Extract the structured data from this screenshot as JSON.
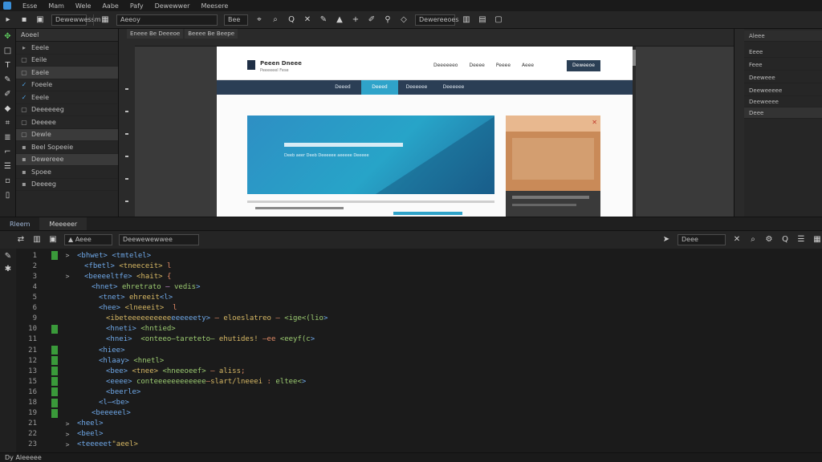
{
  "menubar": {
    "items": [
      "Esse",
      "Mam",
      "Wele",
      "Aabe",
      "Pafy",
      "Dewewwer",
      "Meesere"
    ]
  },
  "toolbar": {
    "workspace": "Dewewwessm",
    "view": "Aeeoy",
    "mode": "Bee",
    "right_label": "Dewereeoes",
    "accent_color": "#3a8fd8"
  },
  "left_panel": {
    "title": "Aoeel",
    "layers": [
      {
        "label": "Eeele"
      },
      {
        "label": "Eeile"
      },
      {
        "label": "Eaele"
      },
      {
        "label": "Foeele"
      },
      {
        "label": "Eeele"
      },
      {
        "label": "Deeeeeeg"
      },
      {
        "label": "Deeeee"
      },
      {
        "label": "Dewle"
      },
      {
        "label": "Beel Sopeeie"
      },
      {
        "label": "Dewereee"
      },
      {
        "label": "Spoee"
      },
      {
        "label": "Deeeeg"
      }
    ]
  },
  "canvas": {
    "tabs": [
      "Eneee Be Deeeoe",
      "Beeee Be Beepe"
    ],
    "site": {
      "title": "Peeen Dneee",
      "subtitle": "Peeeeeel Fese",
      "nav": [
        "Deeeeeeo",
        "Deeee",
        "Peeee",
        "Aeee"
      ],
      "cta": "Deweeoe",
      "menu": [
        "Deeed",
        "Deeed",
        "Deeeeee",
        "Deeeeee"
      ],
      "hero_tagline": "Deeb aeer Deeb Deeeeee aeeeee Deeeee"
    }
  },
  "right_panel": {
    "title": "Aleee",
    "items": [
      "Eeee",
      "Feee",
      "Deeweee",
      "Deeweeeee",
      "Deeweeee",
      "Deee"
    ]
  },
  "editor": {
    "tabs": [
      "Rleem",
      "Meeeeer"
    ],
    "search_label": "Deee",
    "file_label": "Deewewewwee",
    "lines": [
      {
        "n": "1",
        "green": true,
        "fold": ">",
        "indent": 0,
        "html": "<span class='tag'>&lt;bhwet&gt;</span> <span class='tag'>&lt;tmtelel&gt;</span>"
      },
      {
        "n": "2",
        "green": false,
        "fold": "",
        "indent": 1,
        "html": "<span class='tag'>&lt;fbetl&gt;</span> <span class='attr'>&lt;tneeceit&gt;</span> <span class='op'>l</span>"
      },
      {
        "n": "3",
        "green": false,
        "fold": ">",
        "indent": 1,
        "html": "<span class='tag'>&lt;beeeeltfe&gt;</span> <span class='attr'>&lt;hait&gt;</span> <span class='op'>{</span>"
      },
      {
        "n": "4",
        "green": false,
        "fold": "",
        "indent": 2,
        "html": "<span class='tag'>&lt;hnet&gt;</span> <span class='txt'>ehretrato</span> <span class='str'>–</span> <span class='txt'>vedis</span><span class='tag'>&gt;</span>"
      },
      {
        "n": "5",
        "green": false,
        "fold": "",
        "indent": 3,
        "html": "<span class='tag'>&lt;tnet&gt;</span> <span class='attr'>ehreeit</span><span class='tag'>&lt;l&gt;</span>"
      },
      {
        "n": "6",
        "green": false,
        "fold": "",
        "indent": 3,
        "html": "<span class='tag'>&lt;hee&gt;</span> <span class='attr'>&lt;lneeeit&gt;</span>  <span class='op'>l</span>"
      },
      {
        "n": "9",
        "green": false,
        "fold": "",
        "indent": 4,
        "html": "<span class='attr'>&lt;ibeteeeeeeeeee</span><span class='tag'>eeeeeety&gt;</span> <span class='op'>–</span> <span class='attr'>eloeslatreo</span> <span class='op'>–</span> <span class='txt'>&lt;ige&lt;(lio</span><span class='tag'>&gt;</span>"
      },
      {
        "n": "10",
        "green": true,
        "fold": "",
        "indent": 4,
        "html": "<span class='tag'>&lt;hneti&gt;</span> <span class='txt'>&lt;hntied&gt;</span>"
      },
      {
        "n": "11",
        "green": false,
        "fold": "",
        "indent": 4,
        "html": "<span class='tag'>&lt;hnei&gt;</span>  <span class='txt'>&lt;onteeo–tareteto–</span> <span class='attr'>ehutides!</span> <span class='op'>–ee</span> <span class='txt'>&lt;eeyf(c</span><span class='tag'>&gt;</span>"
      },
      {
        "n": "21",
        "green": true,
        "fold": "",
        "indent": 3,
        "html": "<span class='tag'>&lt;hiee&gt;</span>"
      },
      {
        "n": "12",
        "green": true,
        "fold": "",
        "indent": 3,
        "html": "<span class='tag'>&lt;hlaay&gt;</span> <span class='txt'>&lt;hnetl&gt;</span>"
      },
      {
        "n": "13",
        "green": true,
        "fold": "",
        "indent": 4,
        "html": "<span class='tag'>&lt;bee&gt;</span> <span class='attr'>&lt;tnee&gt;</span> <span class='txt'>&lt;hneeoeef&gt;</span> <span class='op'>–</span> <span class='attr'>aliss</span><span class='op'>;</span>"
      },
      {
        "n": "15",
        "green": true,
        "fold": "",
        "indent": 4,
        "html": "<span class='tag'>&lt;eeee&gt;</span> <span class='txt'>conteeeeeeeeeeee</span><span class='op'>–</span><span class='attr'>slart/lneeei</span> <span class='op'>:</span> <span class='txt'>eltee&lt;</span><span class='tag'>&gt;</span>"
      },
      {
        "n": "16",
        "green": true,
        "fold": "",
        "indent": 4,
        "html": "<span class='tag'>&lt;beerle&gt;</span>"
      },
      {
        "n": "18",
        "green": true,
        "fold": "",
        "indent": 3,
        "html": "<span class='tag'>&lt;l–&lt;be&gt;</span>"
      },
      {
        "n": "19",
        "green": true,
        "fold": "",
        "indent": 2,
        "html": "<span class='tag'>&lt;beeeeel&gt;</span>"
      },
      {
        "n": "21",
        "green": false,
        "fold": ">",
        "indent": 0,
        "html": "<span class='tag'>&lt;heel&gt;</span>"
      },
      {
        "n": "22",
        "green": false,
        "fold": ">",
        "indent": 0,
        "html": "<span class='tag'>&lt;beel&gt;</span>"
      },
      {
        "n": "23",
        "green": false,
        "fold": ">",
        "indent": 0,
        "html": "<span class='tag'>&lt;teeeeet</span><span class='attr'>\"aeel&gt;</span>"
      }
    ]
  },
  "status": {
    "text": "Dy Aleeeee"
  }
}
